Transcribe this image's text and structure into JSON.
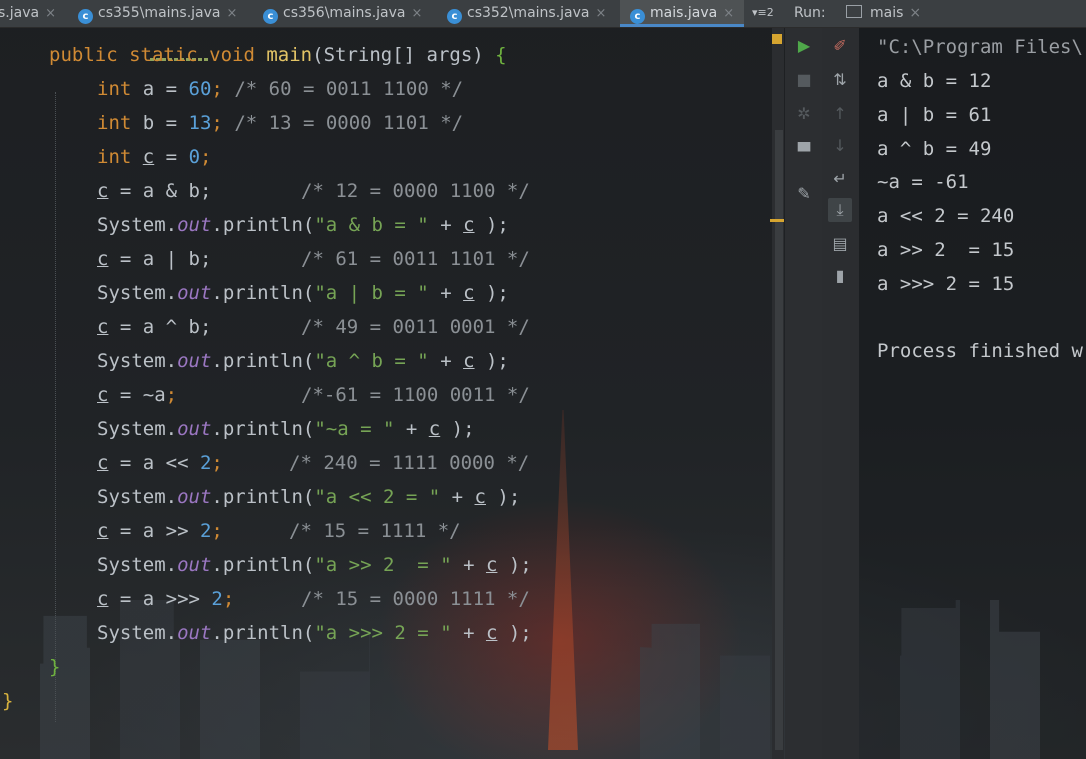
{
  "tabs": [
    {
      "label": "s.java",
      "icon": "none"
    },
    {
      "label": "cs355\\mains.java",
      "icon": "java-class-icon"
    },
    {
      "label": "cs356\\mains.java",
      "icon": "java-class-icon"
    },
    {
      "label": "cs352\\mains.java",
      "icon": "java-class-icon"
    },
    {
      "label": "mais.java",
      "icon": "java-class-icon",
      "active": true
    }
  ],
  "tab_overflow": "▾≡2",
  "tab_close": "×",
  "run_panel": {
    "label": "Run:",
    "config_name": "mais",
    "close": "×"
  },
  "code": {
    "l1_kw": "public static void",
    "l1_fn": "main",
    "l1_args": "(String[] args)",
    "l1_brace": "{",
    "l2_kw": "int",
    "l2_a": " a = ",
    "l2_num": "60",
    "l2_cm": "/* 60 = 0011 1100 */",
    "l3_kw": "int",
    "l3_a": " b = ",
    "l3_num": "13",
    "l3_cm": "/* 13 = 0000 1101 */",
    "l4_kw": "int",
    "l4_v": "c",
    "l4_num": "0",
    "l5_expr": " = a & b;",
    "l5_cm": "/* 12 = 0000 1100 */",
    "l6_str": "\"a & b = \"",
    "l7_expr": " = a | b;",
    "l7_cm": "/* 61 = 0011 1101 */",
    "l8_str": "\"a | b = \"",
    "l9_expr": " = a ^ b;",
    "l9_cm": "/* 49 = 0011 0001 */",
    "l10_str": "\"a ^ b = \"",
    "l11_expr": " = ~a",
    "l11_cm": "/*-61 = 1100 0011 */",
    "l12_str": "\"~a = \"",
    "l13_expr": " = a << ",
    "l13_num": "2",
    "l13_cm": "/* 240 = 1111 0000 */",
    "l14_str": "\"a << 2 = \"",
    "l15_expr": " = a >> ",
    "l15_num": "2",
    "l15_cm": "/* 15 = 1111 */",
    "l16_str": "\"a >> 2  = \"",
    "l17_expr": " = a >>> ",
    "l17_num": "2",
    "l17_cm": "/* 15 = 0000 1111 */",
    "l18_str": "\"a >>> 2 = \"",
    "l19_brace": "}",
    "l20_brace": "}",
    "var_c": "c",
    "system": "System.",
    "out": "out",
    "println": ".println(",
    "plus": " + ",
    "close": " );",
    "semi": ";",
    "close_brace": "}"
  },
  "console": {
    "lines": [
      "\"C:\\Program Files\\",
      "a & b = 12",
      "a | b = 61",
      "a ^ b = 49",
      "~a = -61",
      "a << 2 = 240",
      "a >> 2  = 15",
      "a >>> 2 = 15",
      "",
      "Process finished w"
    ]
  },
  "toolbar_icons": {
    "col1": [
      "run-icon",
      "stop-icon",
      "debug-icon",
      "layout-icon",
      "pin-icon"
    ],
    "col2": [
      "clear-icon",
      "sort-icon",
      "up-arrow-icon",
      "down-arrow-icon",
      "soft-wrap-icon",
      "scroll-to-end-icon",
      "print-icon",
      "trash-icon"
    ]
  },
  "colors": {
    "keyword": "#d08a34",
    "number": "#5aa0d8",
    "comment": "#8b9095",
    "string": "#76a455",
    "field": "#9b77c2",
    "method": "#e3c466",
    "active_tab_underline": "#4a88c7"
  }
}
